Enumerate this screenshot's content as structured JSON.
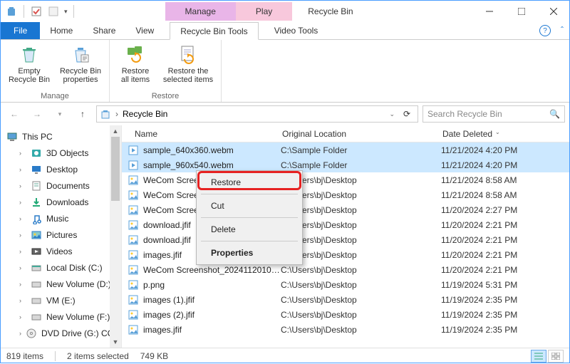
{
  "title": "Recycle Bin",
  "context_tabs": {
    "manage": "Manage",
    "play": "Play"
  },
  "tools": {
    "rb": "Recycle Bin Tools",
    "video": "Video Tools"
  },
  "tabs": {
    "file": "File",
    "home": "Home",
    "share": "Share",
    "view": "View"
  },
  "ribbon": {
    "manage_group": "Manage",
    "restore_group": "Restore",
    "empty": "Empty Recycle Bin",
    "props": "Recycle Bin properties",
    "restore_all": "Restore all items",
    "restore_sel": "Restore the selected items"
  },
  "address": {
    "path": "Recycle Bin"
  },
  "search": {
    "placeholder": "Search Recycle Bin"
  },
  "nav": [
    {
      "label": "This PC",
      "icon": "pc",
      "exp": true
    },
    {
      "label": "3D Objects",
      "icon": "3d"
    },
    {
      "label": "Desktop",
      "icon": "desktop"
    },
    {
      "label": "Documents",
      "icon": "docs"
    },
    {
      "label": "Downloads",
      "icon": "downloads"
    },
    {
      "label": "Music",
      "icon": "music"
    },
    {
      "label": "Pictures",
      "icon": "pictures"
    },
    {
      "label": "Videos",
      "icon": "videos"
    },
    {
      "label": "Local Disk (C:)",
      "icon": "disk"
    },
    {
      "label": "New Volume (D:)",
      "icon": "drive"
    },
    {
      "label": "VM (E:)",
      "icon": "drive"
    },
    {
      "label": "New Volume (F:)",
      "icon": "drive"
    },
    {
      "label": "DVD Drive (G:) CCC",
      "icon": "dvd"
    }
  ],
  "columns": {
    "name": "Name",
    "ol": "Original Location",
    "dd": "Date Deleted"
  },
  "files": [
    {
      "name": "sample_640x360.webm",
      "ol": "C:\\Sample Folder",
      "dd": "11/21/2024 4:20 PM",
      "icon": "video",
      "sel": true
    },
    {
      "name": "sample_960x540.webm",
      "ol": "C:\\Sample Folder",
      "dd": "11/21/2024 4:20 PM",
      "icon": "video",
      "sel": true
    },
    {
      "name": "WeCom Screenshot_202411210858...",
      "ol": "C:\\Users\\bj\\Desktop",
      "dd": "11/21/2024 8:58 AM",
      "icon": "img"
    },
    {
      "name": "WeCom Screenshot_202411210858...",
      "ol": "C:\\Users\\bj\\Desktop",
      "dd": "11/21/2024 8:58 AM",
      "icon": "img"
    },
    {
      "name": "WeCom Screenshot_202411201427...",
      "ol": "C:\\Users\\bj\\Desktop",
      "dd": "11/20/2024 2:27 PM",
      "icon": "img"
    },
    {
      "name": "download.jfif",
      "ol": "C:\\Users\\bj\\Desktop",
      "dd": "11/20/2024 2:21 PM",
      "icon": "img"
    },
    {
      "name": "download.jfif",
      "ol": "C:\\Users\\bj\\Desktop",
      "dd": "11/20/2024 2:21 PM",
      "icon": "img"
    },
    {
      "name": "images.jfif",
      "ol": "C:\\Users\\bj\\Desktop",
      "dd": "11/20/2024 2:21 PM",
      "icon": "img"
    },
    {
      "name": "WeCom Screenshot_202411201014...",
      "ol": "C:\\Users\\bj\\Desktop",
      "dd": "11/20/2024 2:21 PM",
      "icon": "img"
    },
    {
      "name": "p.png",
      "ol": "C:\\Users\\bj\\Desktop",
      "dd": "11/19/2024 5:31 PM",
      "icon": "img"
    },
    {
      "name": "images (1).jfif",
      "ol": "C:\\Users\\bj\\Desktop",
      "dd": "11/19/2024 2:35 PM",
      "icon": "img"
    },
    {
      "name": "images (2).jfif",
      "ol": "C:\\Users\\bj\\Desktop",
      "dd": "11/19/2024 2:35 PM",
      "icon": "img"
    },
    {
      "name": "images.jfif",
      "ol": "C:\\Users\\bj\\Desktop",
      "dd": "11/19/2024 2:35 PM",
      "icon": "img"
    }
  ],
  "context_menu": {
    "restore": "Restore",
    "cut": "Cut",
    "delete": "Delete",
    "properties": "Properties"
  },
  "status": {
    "count": "819 items",
    "selected": "2 items selected",
    "size": "749 KB"
  }
}
